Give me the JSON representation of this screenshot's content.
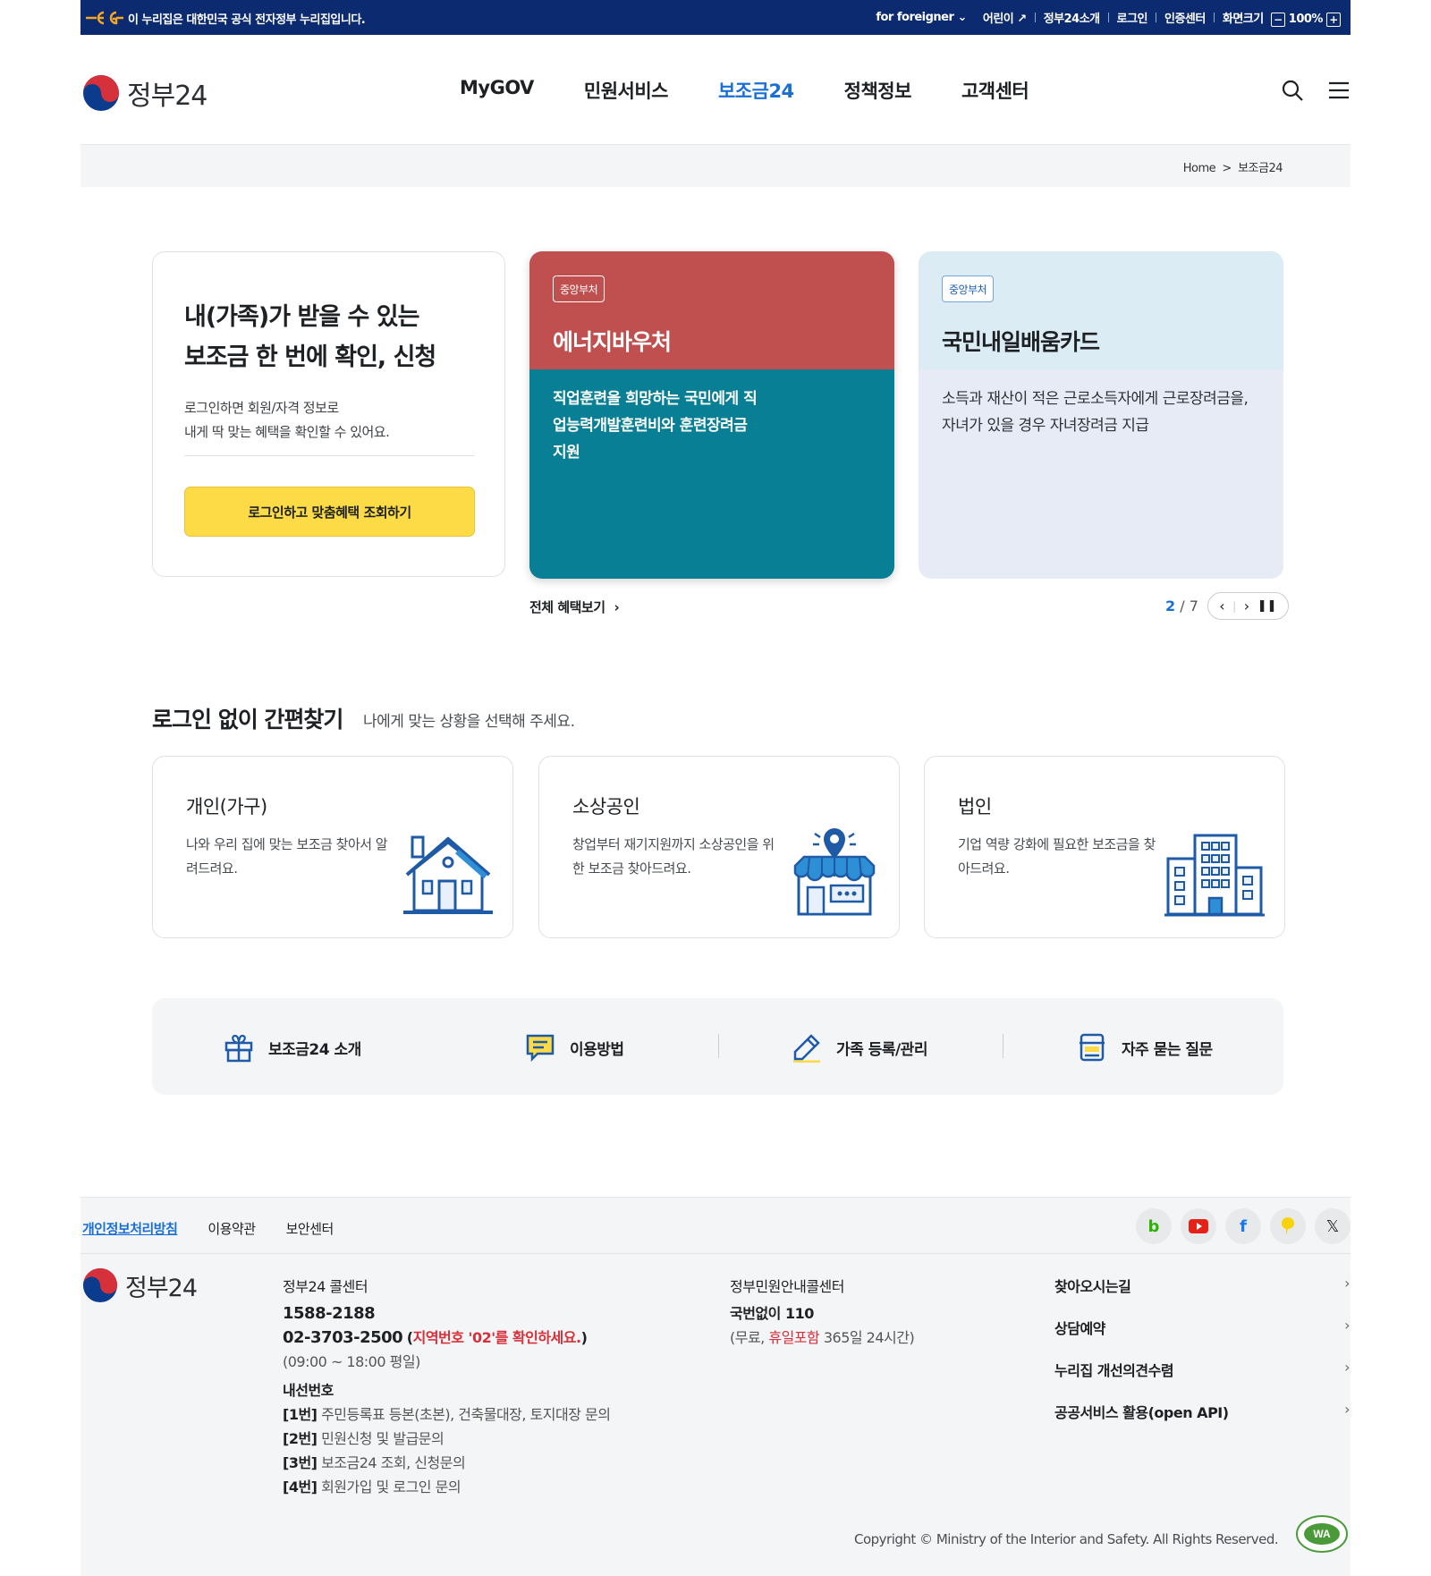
{
  "topbar": {
    "notice": "이 누리집은 대한민국 공식 전자정부 누리집입니다.",
    "foreigner": "for foreigner",
    "kids": "어린이",
    "about": "정부24소개",
    "login": "로그인",
    "cert": "인증센터",
    "zoom_label": "화면크기",
    "zoom_value": "100%",
    "zoom_minus": "−",
    "zoom_plus": "+"
  },
  "header": {
    "logo_text": "정부24",
    "nav": [
      "MyGOV",
      "민원서비스",
      "보조금24",
      "정책정보",
      "고객센터"
    ],
    "active_nav": "보조금24"
  },
  "breadcrumb": {
    "home": "Home",
    "sep": ">",
    "current": "보조금24"
  },
  "login_card": {
    "title_line1": "내(가족)가 받을 수 있는",
    "title_line2": "보조금 한 번에 확인, 신청",
    "desc_line1": "로그인하면 회원/자격 정보로",
    "desc_line2": "내게 딱 맞는 혜택을 확인할 수 있어요.",
    "button": "로그인하고 맞춤혜택 조회하기"
  },
  "benefit_cards": [
    {
      "tag": "중앙부처",
      "title": "에너지바우처",
      "desc": "직업훈련을 희망하는 국민에게 직업능력개발훈련비와 훈련장려금 지원",
      "top_color": "#c0504f",
      "bottom_color": "#087f94"
    },
    {
      "tag": "중앙부처",
      "title": "국민내일배움카드",
      "desc": "소득과 재산이 적은 근로소득자에게 근로장려금을, 자녀가 있을 경우 자녀장려금 지급",
      "top_color": "#dcecf4",
      "bottom_color": "#e6ebf5"
    }
  ],
  "carousel": {
    "all_link": "전체 혜택보기",
    "current": "2",
    "total": "7",
    "sep": "/"
  },
  "quick": {
    "title": "로그인 없이 간편찾기",
    "subtitle": "나에게 맞는 상황을 선택해 주세요.",
    "cards": [
      {
        "title": "개인(가구)",
        "desc": "나와 우리 집에 맞는 보조금 찾아서 알려드려요.",
        "icon": "house-icon"
      },
      {
        "title": "소상공인",
        "desc": "창업부터 재기지원까지 소상공인을 위한 보조금 찾아드려요.",
        "icon": "store-icon"
      },
      {
        "title": "법인",
        "desc": "기업 역량 강화에 필요한 보조금을 찾아드려요.",
        "icon": "building-icon"
      }
    ]
  },
  "utilities": [
    {
      "label": "보조금24 소개",
      "icon": "gift-icon"
    },
    {
      "label": "이용방법",
      "icon": "chat-icon"
    },
    {
      "label": "가족 등록/관리",
      "icon": "pencil-icon"
    },
    {
      "label": "자주 묻는 질문",
      "icon": "faq-icon"
    }
  ],
  "footer": {
    "links": [
      "개인정보처리방침",
      "이용약관",
      "보안센터"
    ],
    "social": [
      "blog",
      "youtube",
      "facebook",
      "kakao",
      "x"
    ],
    "logo_text": "정부24",
    "call_title": "정부24 콜센터",
    "call_number1": "1588-2188",
    "call_number2": "02-3703-2500",
    "call_note_open": "(",
    "call_note": "지역번호 '02'를 확인하세요.",
    "call_note_close": ")",
    "call_hours": "(09:00 ~ 18:00 평일)",
    "ext_title": "내선번호",
    "ext": [
      {
        "no": "[1번]",
        "text": "주민등록표 등본(초본), 건축물대장, 토지대장 문의"
      },
      {
        "no": "[2번]",
        "text": "민원신청 및 발급문의"
      },
      {
        "no": "[3번]",
        "text": "보조금24 조회, 신청문의"
      },
      {
        "no": "[4번]",
        "text": "회원가입 및 로그인 문의"
      }
    ],
    "guide_title": "정부민원안내콜센터",
    "guide_number": "국번없이 110",
    "guide_note_pre": "(무료, ",
    "guide_note_red": "휴일포함",
    "guide_note_post": " 365일 24시간)",
    "quick_links": [
      "찾아오시는길",
      "상담예약",
      "누리집 개선의견수렴",
      "공공서비스 활용(open API)"
    ],
    "copyright": "Copyright © Ministry of the Interior and Safety. All Rights Reserved."
  }
}
